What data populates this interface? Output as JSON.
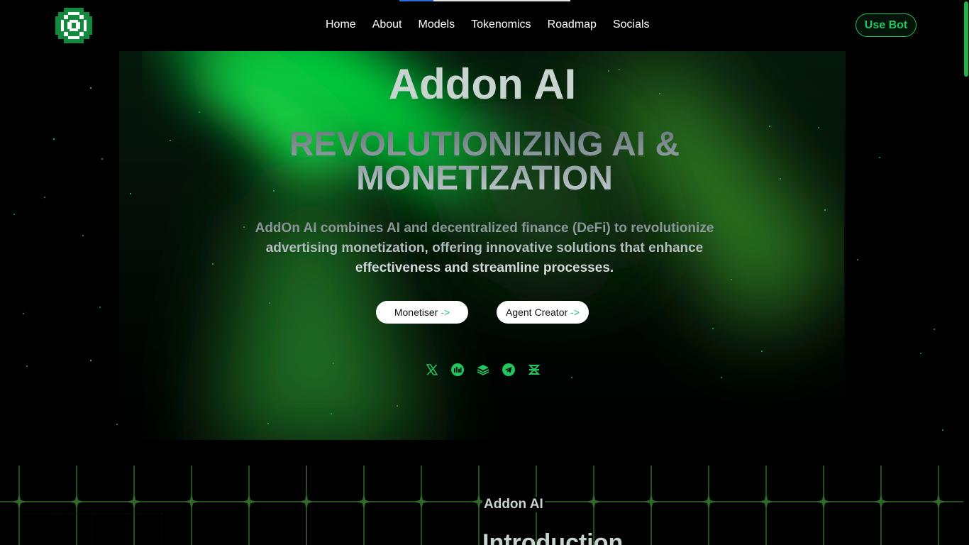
{
  "page": {
    "brand_color": "#22c55e",
    "background": "#000000"
  },
  "top_progress": {
    "fraction": 0.2
  },
  "header": {
    "logo_icon": "target-logo-icon",
    "nav": [
      "Home",
      "About",
      "Models",
      "Tokenomics",
      "Roadmap",
      "Socials"
    ],
    "cta_label": "Use Bot"
  },
  "hero": {
    "brand_title": "Addon AI",
    "headline_line1": "REVOLUTIONIZING AI &",
    "headline_line2": "MONETIZATION",
    "description": "AddOn AI combines AI and decentralized finance (DeFi) to revolutionize advertising monetization, offering innovative solutions that enhance effectiveness and streamline processes.",
    "buttons": [
      {
        "label": "Monetiser",
        "arrow": "->"
      },
      {
        "label": "Agent Creator",
        "arrow": "->"
      }
    ],
    "social_icons": [
      "x-icon",
      "chart-icon",
      "layers-icon",
      "telegram-icon",
      "dexscreener-icon"
    ]
  },
  "intro": {
    "eyebrow": "Addon AI",
    "title": "Introduction"
  }
}
